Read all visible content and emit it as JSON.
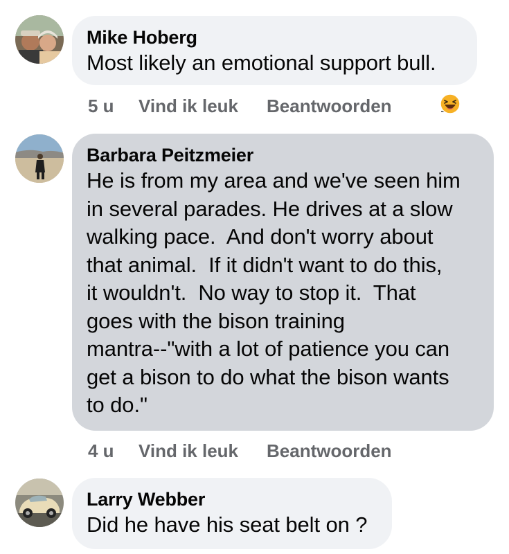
{
  "comments": [
    {
      "author": "Mike Hoberg",
      "text": "Most likely an emotional support bull.",
      "time": "5 u",
      "like_label": "Vind ik leuk",
      "reply_label": "Beantwoorden",
      "reaction_count": "1",
      "reaction_icon": "haha-emoji-icon"
    },
    {
      "author": "Barbara Peitzmeier",
      "text": "He is from my area and we've seen him\nin several parades. He drives at a slow\nwalking pace.  And don't worry about\nthat animal.  If it didn't want to do this,\nit wouldn't.  No way to stop it.  That\ngoes with the bison training\nmantra--\"with a lot of patience you can\nget a bison to do what the bison wants\nto do.\"",
      "time": "4 u",
      "like_label": "Vind ik leuk",
      "reply_label": "Beantwoorden"
    },
    {
      "author": "Larry Webber",
      "text": "Did he have his seat belt on ?"
    }
  ],
  "colors": {
    "bubble_default": "#f0f2f5",
    "bubble_selected": "#d3d6db",
    "meta_text": "#65676b",
    "reaction_haha": "#f7b125"
  }
}
